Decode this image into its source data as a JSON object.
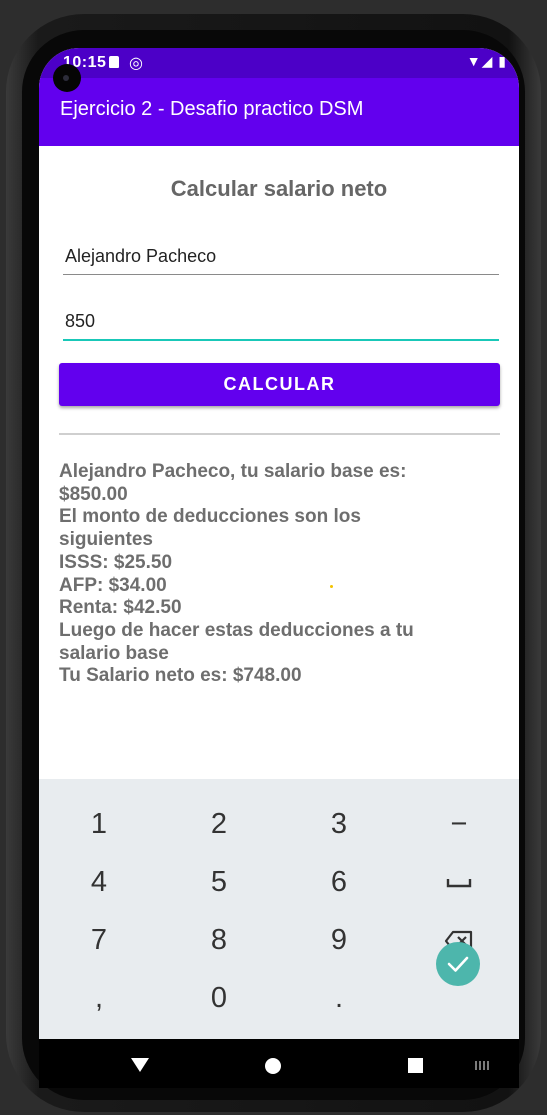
{
  "status_bar": {
    "time": "10:15",
    "circle_glyph": "◎",
    "right_icons": "▼◢ ▮"
  },
  "app_bar": {
    "title": "Ejercicio 2 - Desafio practico DSM"
  },
  "form": {
    "heading": "Calcular salario neto",
    "name_value": "Alejandro Pacheco",
    "salary_value": "850",
    "calculate_label": "CALCULAR"
  },
  "result": {
    "lines": [
      "Alejandro Pacheco, tu salario base es:",
      "$850.00",
      "El monto de deducciones son los",
      "siguientes",
      "ISSS: $25.50",
      "AFP: $34.00",
      "Renta: $42.50",
      "Luego de hacer estas deducciones a tu",
      "salario base",
      "Tu Salario neto es: $748.00"
    ]
  },
  "keyboard": {
    "rows": [
      [
        "1",
        "2",
        "3",
        "−"
      ],
      [
        "4",
        "5",
        "6",
        "space"
      ],
      [
        "7",
        "8",
        "9",
        "backspace"
      ],
      [
        ",",
        "0",
        ".",
        "done"
      ]
    ]
  },
  "colors": {
    "status_bar": "#4c00c7",
    "app_bar": "#6200ee",
    "button": "#6200ee",
    "field_focus": "#19c8b8",
    "done_key": "#4db6ac",
    "keyboard_bg": "#e8ecef"
  },
  "icons": {
    "space_key": "space-bar-icon",
    "backspace_key": "backspace-icon",
    "done_key": "check-icon",
    "nav_back": "back-triangle-icon",
    "nav_home": "home-circle-icon",
    "nav_recents": "recents-square-icon"
  }
}
